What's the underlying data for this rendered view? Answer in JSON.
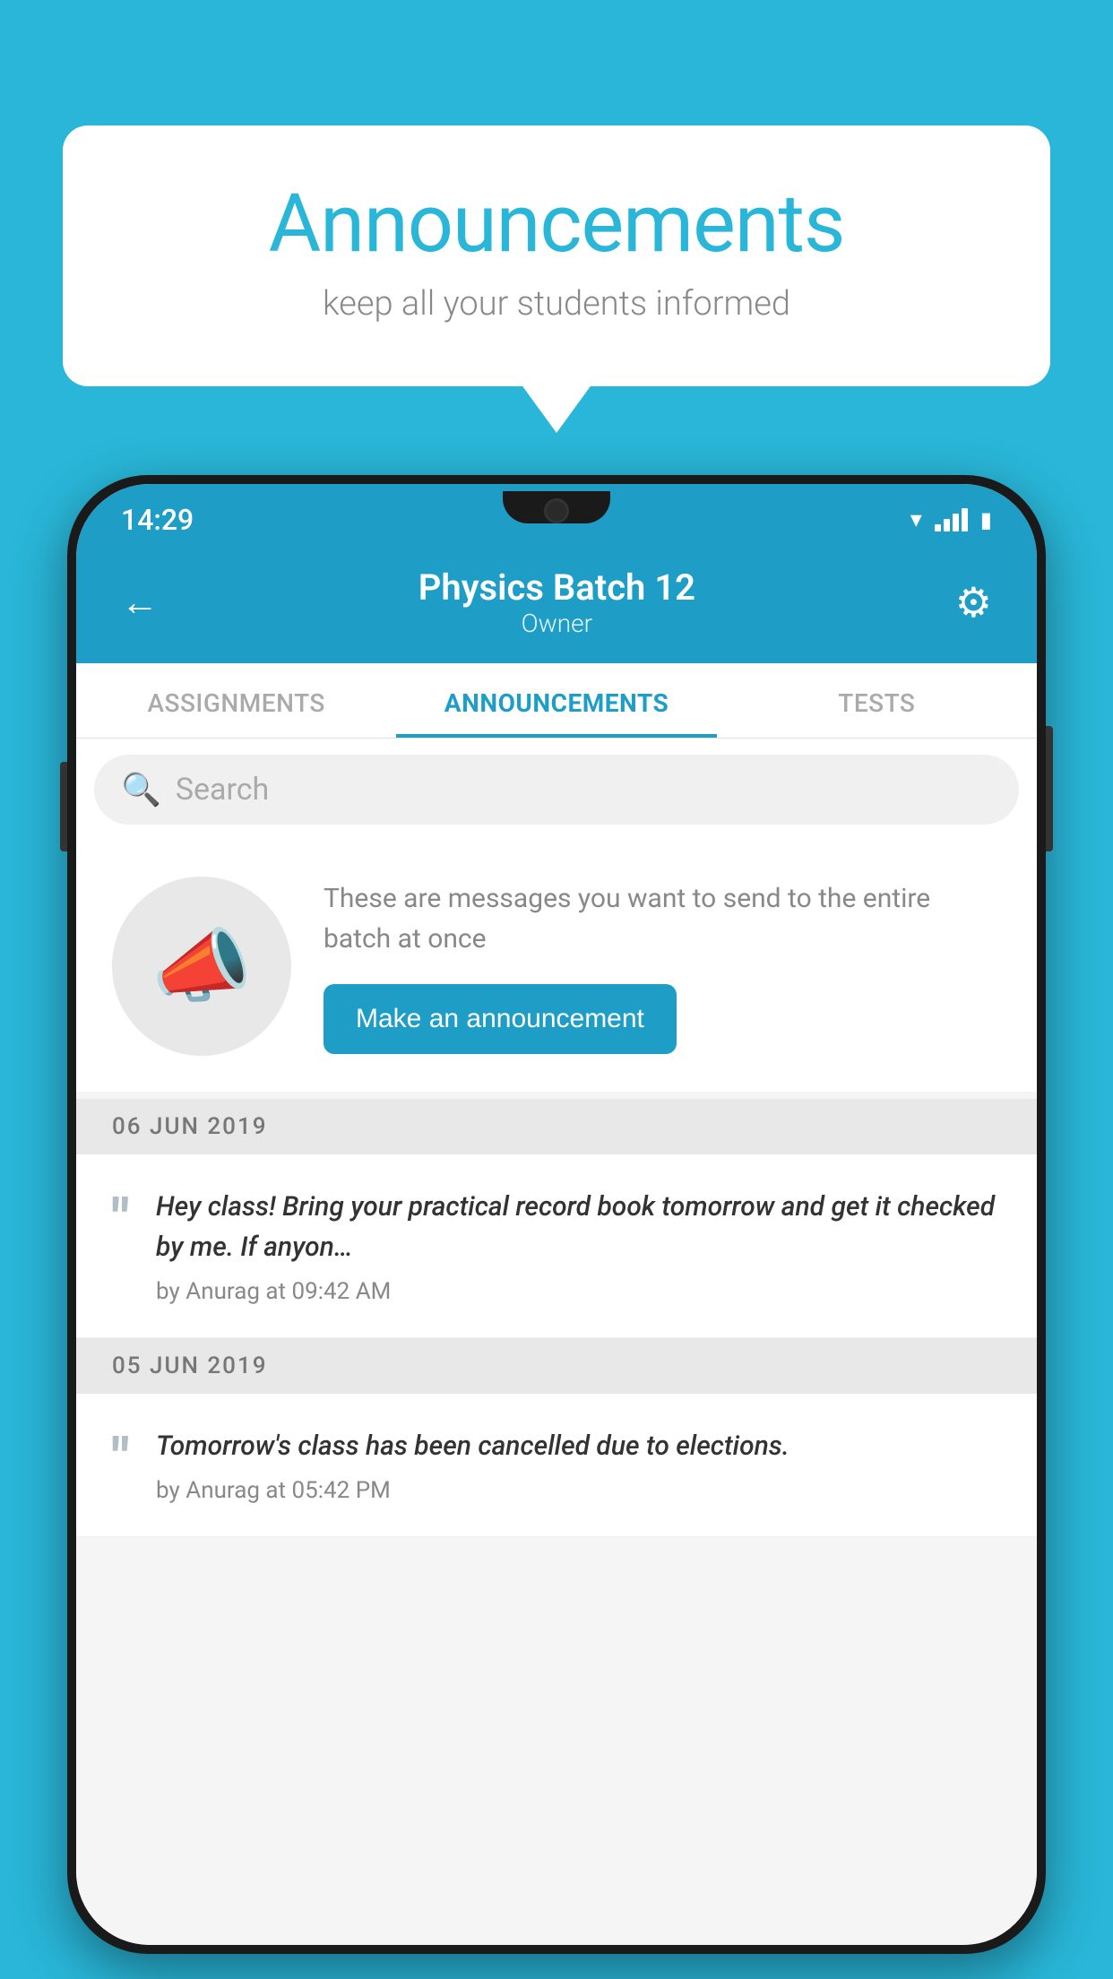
{
  "background_color": "#29b6d8",
  "speech_bubble": {
    "title": "Announcements",
    "subtitle": "keep all your students informed"
  },
  "status_bar": {
    "time": "14:29"
  },
  "app_header": {
    "title": "Physics Batch 12",
    "subtitle": "Owner",
    "back_label": "←",
    "gear_symbol": "⚙"
  },
  "tabs": [
    {
      "label": "ASSIGNMENTS",
      "active": false
    },
    {
      "label": "ANNOUNCEMENTS",
      "active": true
    },
    {
      "label": "TESTS",
      "active": false
    }
  ],
  "search": {
    "placeholder": "Search"
  },
  "announcement_prompt": {
    "description_text": "These are messages you want to send to the entire batch at once",
    "button_label": "Make an announcement"
  },
  "announcements": [
    {
      "date": "06  JUN  2019",
      "items": [
        {
          "text": "Hey class! Bring your practical record book tomorrow and get it checked by me. If anyon…",
          "meta": "by Anurag at 09:42 AM"
        }
      ]
    },
    {
      "date": "05  JUN  2019",
      "items": [
        {
          "text": "Tomorrow's class has been cancelled due to elections.",
          "meta": "by Anurag at 05:42 PM"
        }
      ]
    }
  ]
}
